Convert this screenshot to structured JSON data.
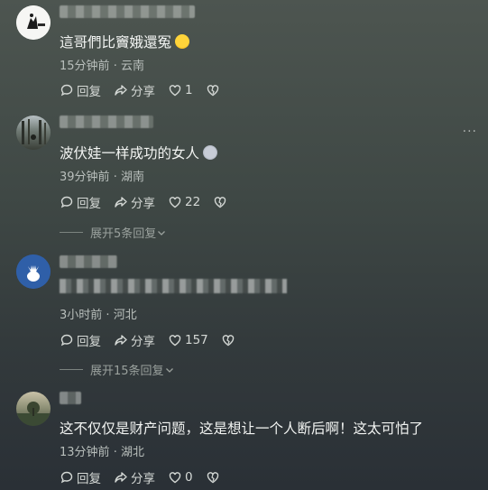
{
  "comments": [
    {
      "text": "這哥們比竇娥還冤",
      "time": "15分钟前",
      "region": "云南",
      "reply_label": "回复",
      "share_label": "分享",
      "like_count": "1",
      "replies_expand": ""
    },
    {
      "text": "波伏娃一样成功的女人",
      "time": "39分钟前",
      "region": "湖南",
      "reply_label": "回复",
      "share_label": "分享",
      "like_count": "22",
      "replies_expand": "展开5条回复"
    },
    {
      "text": "",
      "time": "3小时前",
      "region": "河北",
      "reply_label": "回复",
      "share_label": "分享",
      "like_count": "157",
      "replies_expand": "展开15条回复"
    },
    {
      "text": "这不仅仅是财产问题，这是想让一个人断后啊！这太可怕了",
      "time": "13分钟前",
      "region": "湖北",
      "reply_label": "回复",
      "share_label": "分享",
      "like_count": "0",
      "replies_expand": ""
    }
  ],
  "separator": "·",
  "more_label": "···",
  "icons": {
    "reply": "reply-bubble-icon",
    "share": "share-arrow-icon",
    "like": "heart-icon",
    "dislike": "broken-heart-icon",
    "expand": "chevron-down-icon"
  },
  "colors": {
    "text": "#f2f4f2",
    "meta": "#b9bfbc",
    "muted": "#9aa19d"
  }
}
